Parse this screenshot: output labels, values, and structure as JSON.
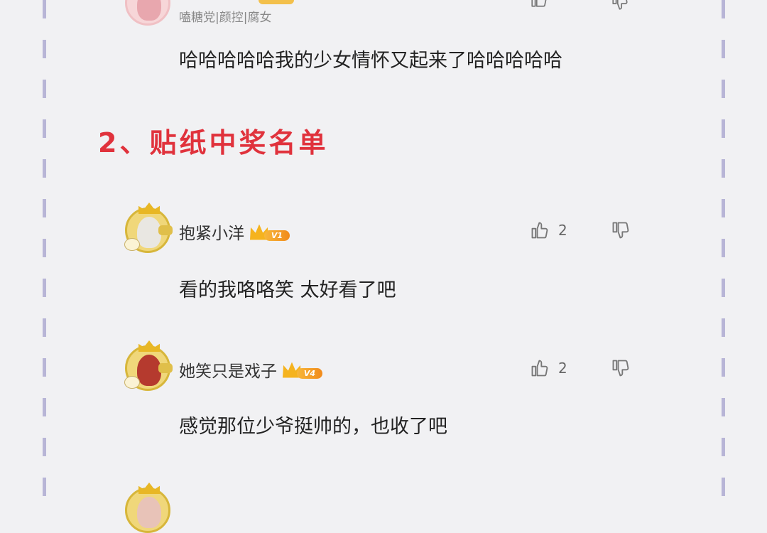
{
  "colors": {
    "accent": "#e0323c",
    "background": "#f1f1f3",
    "dash": "#b8b5d6",
    "vip": "#f5a020"
  },
  "top_partial": {
    "tags": "嗑糖党|颜控|腐女",
    "comment": "哈哈哈哈哈我的少女情怀又起来了哈哈哈哈哈"
  },
  "section": {
    "title": "2、贴纸中奖名单"
  },
  "comments": [
    {
      "username": "抱紧小洋",
      "level": "V1",
      "likes": "2",
      "text": "看的我咯咯笑 太好看了吧"
    },
    {
      "username": "她笑只是戏子",
      "level": "V4",
      "likes": "2",
      "text": "感觉那位少爷挺帅的，也收了吧"
    }
  ],
  "icons": {
    "like": "thumbs-up-icon",
    "dislike": "thumbs-down-icon"
  }
}
